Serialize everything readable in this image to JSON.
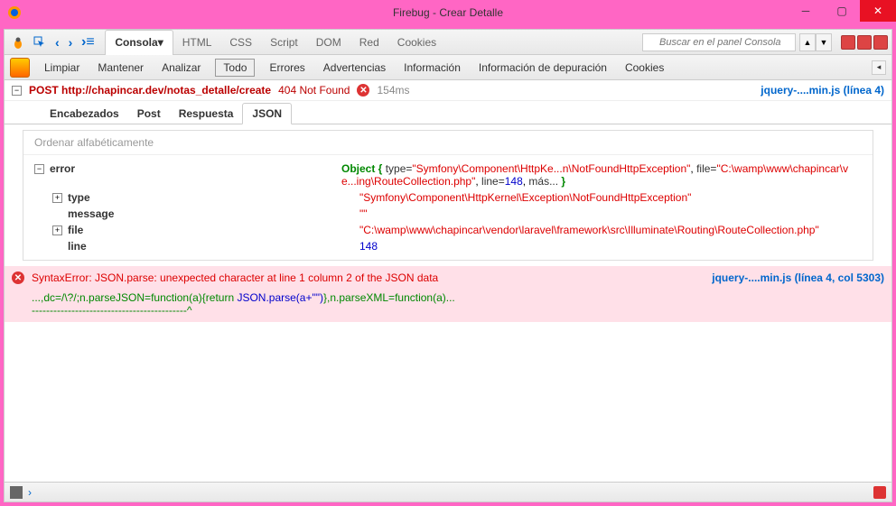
{
  "window": {
    "title": "Firebug - Crear Detalle"
  },
  "toolbar1": {
    "tabs": [
      "Consola",
      "HTML",
      "CSS",
      "Script",
      "DOM",
      "Red",
      "Cookies"
    ],
    "active_tab": 0,
    "search_placeholder": "Buscar en el panel Consola"
  },
  "toolbar2": {
    "items": [
      "Limpiar",
      "Mantener",
      "Analizar",
      "Todo",
      "Errores",
      "Advertencias",
      "Información",
      "Información de depuración",
      "Cookies"
    ],
    "boxed_index": 3
  },
  "request": {
    "method": "POST",
    "url": "http://chapincar.dev/notas_detalle/create",
    "status": "404 Not Found",
    "time": "154ms",
    "source": "jquery-....min.js (línea 4)"
  },
  "subtabs": {
    "items": [
      "Encabezados",
      "Post",
      "Respuesta",
      "JSON"
    ],
    "active_index": 3
  },
  "json_panel": {
    "sort_label": "Ordenar alfabéticamente",
    "root_key": "error",
    "object_prefix": "Object { ",
    "type_label": "type=",
    "type_short": "\"Symfony\\Component\\HttpKe...n\\NotFoundHttpException\"",
    "file_label": "file=",
    "file_short": "\"C:\\wamp\\www\\chapincar\\ve...ing\\RouteCollection.php\"",
    "line_label": "line=",
    "line_short": "148",
    "more_label": "más...",
    "object_suffix": " }",
    "rows": [
      {
        "key": "type",
        "value": "\"Symfony\\Component\\HttpKernel\\Exception\\NotFoundHttpException\"",
        "type": "str",
        "toggle": true
      },
      {
        "key": "message",
        "value": "\"\"",
        "type": "str",
        "toggle": false
      },
      {
        "key": "file",
        "value": "\"C:\\wamp\\www\\chapincar\\vendor\\laravel\\framework\\src\\Illuminate\\Routing\\RouteCollection.php\"",
        "type": "str",
        "toggle": true
      },
      {
        "key": "line",
        "value": "148",
        "type": "num",
        "toggle": false
      }
    ]
  },
  "error": {
    "message": "SyntaxError: JSON.parse: unexpected character at line 1 column 2 of the JSON data",
    "source": "jquery-....min.js (línea 4, col 5303)",
    "code_prefix": "...,dc=/\\?/;n.parseJSON=function(a){return ",
    "code_highlight": "JSON.parse(a+\"\")",
    "code_suffix": "},n.parseXML=function(a)...",
    "arrow_line": "-------------------------------------------^"
  }
}
